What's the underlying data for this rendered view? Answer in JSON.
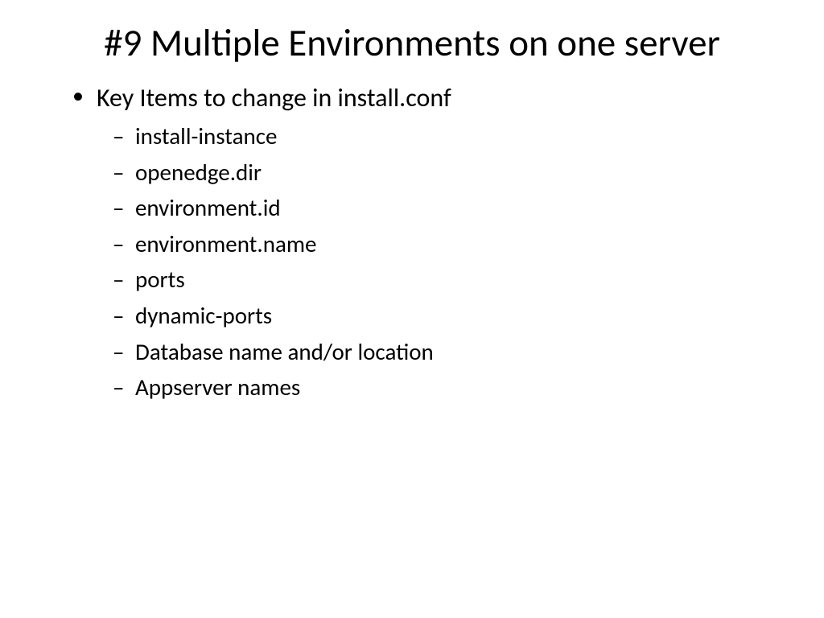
{
  "slide": {
    "title": "#9 Multiple Environments on one server",
    "bullets": [
      {
        "text": "Key Items to change in install.conf",
        "children": [
          "install-instance",
          "openedge.dir",
          "environment.id",
          "environment.name",
          "ports",
          "dynamic-ports",
          "Database name and/or location",
          "Appserver names"
        ]
      }
    ]
  }
}
